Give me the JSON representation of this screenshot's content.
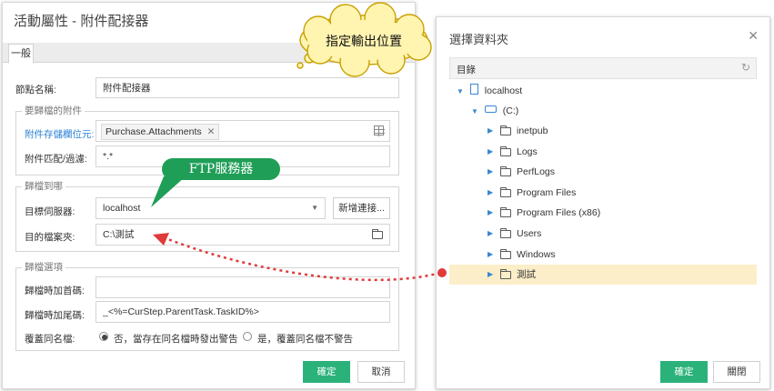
{
  "left_dialog": {
    "title": "活動屬性 - 附件配接器",
    "tab": "一般",
    "node_name_label": "節點名稱:",
    "node_name_value": "附件配接器",
    "section_source": {
      "legend": "要歸檔的附件",
      "storage_label": "附件存儲欄位元:",
      "storage_tag": "Purchase.Attachments",
      "match_label": "附件匹配/過濾:",
      "match_value": "*.*"
    },
    "section_target": {
      "legend": "歸檔到哪",
      "server_label": "目標伺服器:",
      "server_value": "localhost",
      "new_connection": "新增連接...",
      "folder_label": "目的檔案夾:",
      "folder_value": "C:\\測試"
    },
    "section_options": {
      "legend": "歸檔選項",
      "prefix_label": "歸檔時加首碼:",
      "prefix_value": "",
      "suffix_label": "歸檔時加尾碼:",
      "suffix_value": "_<%=CurStep.ParentTask.TaskID%>",
      "overwrite_label": "覆蓋同名檔:",
      "radio_no": "否，當存在同名檔時發出警告",
      "radio_yes": "是，覆蓋同名檔不警告",
      "selected": "no"
    },
    "ok": "確定",
    "cancel": "取消"
  },
  "right_dialog": {
    "title": "選擇資料夾",
    "header": "目錄",
    "tree": {
      "root": "localhost",
      "drive": "(C:)",
      "folders": [
        "inetpub",
        "Logs",
        "PerfLogs",
        "Program Files",
        "Program Files (x86)",
        "Users",
        "Windows",
        "測試"
      ],
      "selected": "測試"
    },
    "ok": "確定",
    "close": "關閉"
  },
  "callouts": {
    "ftp": "FTP服務器",
    "output": "指定輸出位置"
  },
  "colors": {
    "primary_button": "#2bb27a",
    "selected_row": "#fbeec8",
    "callout_green": "#1f9e57",
    "arrow_red": "#e03a3a",
    "link_blue": "#2a7fd4"
  }
}
